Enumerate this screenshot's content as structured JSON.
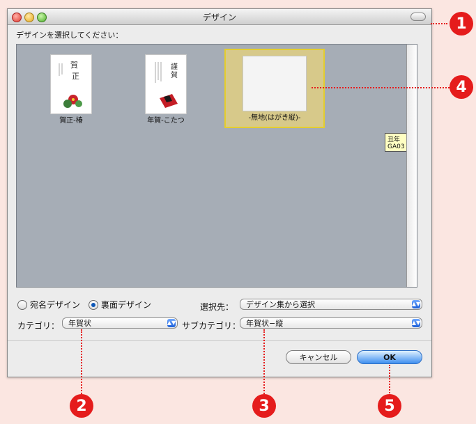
{
  "window": {
    "title": "デザイン"
  },
  "prompt": "デザインを選択してください：",
  "gallery": {
    "items": [
      {
        "label": "賀正-椿"
      },
      {
        "label": "年賀-こたつ"
      },
      {
        "label": "-無地(はがき縦)-"
      }
    ],
    "tooltip": "丑年GA03"
  },
  "options": {
    "radio_address": "宛名デザイン",
    "radio_back": "裏面デザイン",
    "selected_radio": "裏面デザイン",
    "source_label": "選択先：",
    "source_value": "デザイン集から選択",
    "category_label": "カテゴリ：",
    "category_value": "年賀状",
    "subcategory_label": "サブカテゴリ：",
    "subcategory_value": "年賀状−縦"
  },
  "buttons": {
    "cancel": "キャンセル",
    "ok": "OK"
  },
  "annotations": {
    "n1": "1",
    "n2": "2",
    "n3": "3",
    "n4": "4",
    "n5": "5"
  },
  "colors": {
    "annotation": "#e51c1c",
    "gallery_bg": "#a6adb6",
    "selection": "#e4cd2f"
  }
}
